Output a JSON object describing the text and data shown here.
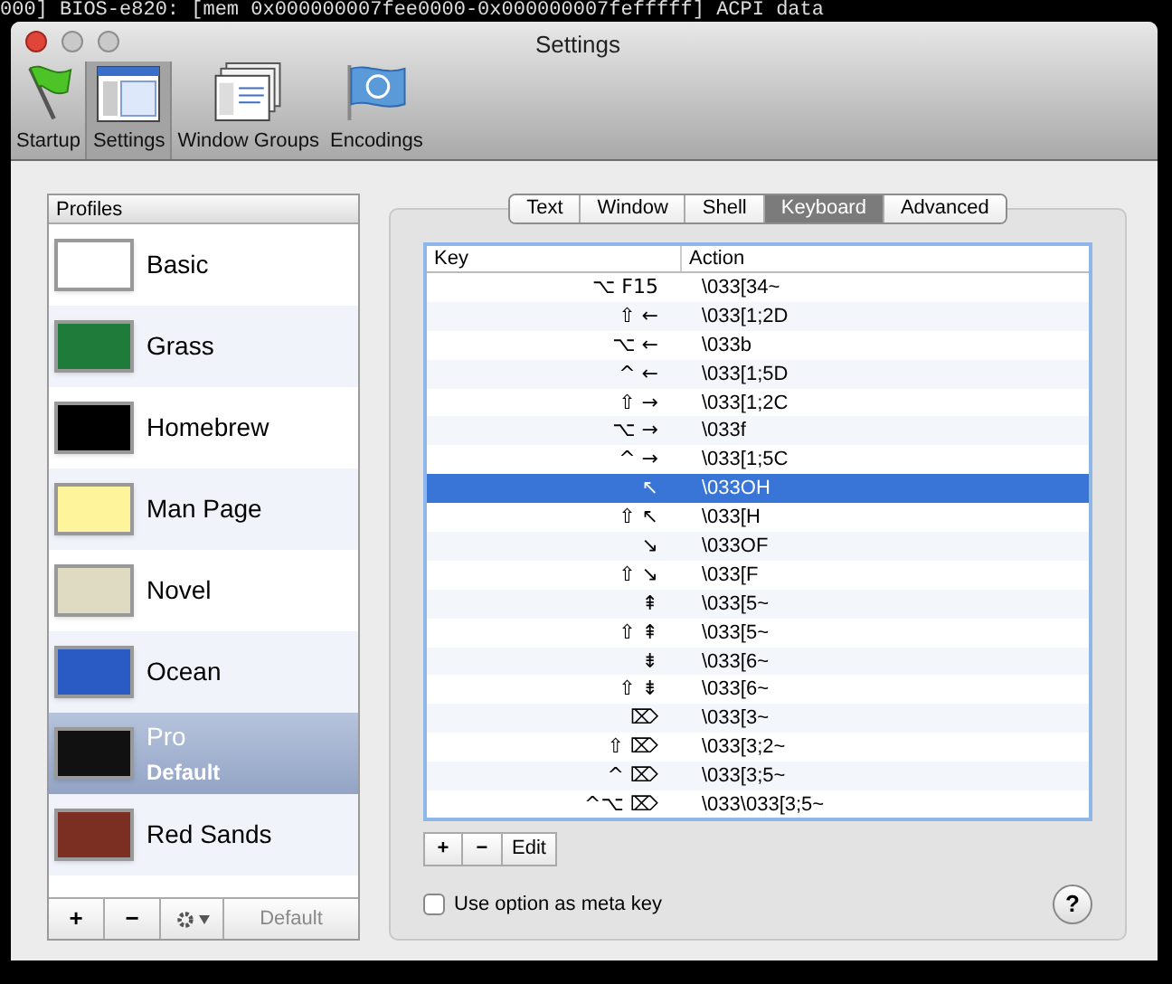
{
  "background_terminal": {
    "line": "000] BIOS-e820: [mem 0x000000007fee0000-0x000000007fefffff] ACPI data"
  },
  "window": {
    "title": "Settings"
  },
  "toolbar": [
    {
      "kind": "flag",
      "label": "Startup",
      "selected": false
    },
    {
      "kind": "settings",
      "label": "Settings",
      "selected": true
    },
    {
      "kind": "groups",
      "label": "Window Groups",
      "selected": false
    },
    {
      "kind": "globe",
      "label": "Encodings",
      "selected": false
    }
  ],
  "profiles": {
    "header": "Profiles",
    "items": [
      {
        "name": "Basic",
        "color": "#ffffff",
        "selected": false
      },
      {
        "name": "Grass",
        "color": "#1e7b3a",
        "selected": false
      },
      {
        "name": "Homebrew",
        "color": "#000000",
        "selected": false
      },
      {
        "name": "Man Page",
        "color": "#fef49c",
        "selected": false
      },
      {
        "name": "Novel",
        "color": "#dfdbc3",
        "selected": false
      },
      {
        "name": "Ocean",
        "color": "#2a5bc4",
        "selected": false
      },
      {
        "name": "Pro",
        "subtitle": "Default",
        "color": "#111111",
        "selected": true
      },
      {
        "name": "Red Sands",
        "color": "#7a2f22",
        "selected": false
      }
    ],
    "buttons": [
      "+",
      "−"
    ],
    "default_button": "Default"
  },
  "tabs": [
    {
      "label": "Text",
      "selected": false
    },
    {
      "label": "Window",
      "selected": false
    },
    {
      "label": "Shell",
      "selected": false
    },
    {
      "label": "Keyboard",
      "selected": true
    },
    {
      "label": "Advanced",
      "selected": false
    }
  ],
  "table": {
    "columns": [
      "Key",
      "Action"
    ],
    "rows": [
      {
        "key": "⌥ F15",
        "action": "\\033[34~",
        "selected": false
      },
      {
        "key": "⇧ ←",
        "action": "\\033[1;2D",
        "selected": false
      },
      {
        "key": "⌥ ←",
        "action": "\\033b",
        "selected": false
      },
      {
        "key": "^ ←",
        "action": "\\033[1;5D",
        "selected": false
      },
      {
        "key": "⇧ →",
        "action": "\\033[1;2C",
        "selected": false
      },
      {
        "key": "⌥ →",
        "action": "\\033f",
        "selected": false
      },
      {
        "key": "^ →",
        "action": "\\033[1;5C",
        "selected": false
      },
      {
        "key": "↖",
        "action": "\\033OH",
        "selected": true
      },
      {
        "key": "⇧ ↖",
        "action": "\\033[H",
        "selected": false
      },
      {
        "key": "↘",
        "action": "\\033OF",
        "selected": false
      },
      {
        "key": "⇧ ↘",
        "action": "\\033[F",
        "selected": false
      },
      {
        "key": "⇞",
        "action": "\\033[5~",
        "selected": false
      },
      {
        "key": "⇧ ⇞",
        "action": "\\033[5~",
        "selected": false
      },
      {
        "key": "⇟",
        "action": "\\033[6~",
        "selected": false
      },
      {
        "key": "⇧ ⇟",
        "action": "\\033[6~",
        "selected": false
      },
      {
        "key": "⌦",
        "action": "\\033[3~",
        "selected": false
      },
      {
        "key": "⇧ ⌦",
        "action": "\\033[3;2~",
        "selected": false
      },
      {
        "key": "^ ⌦",
        "action": "\\033[3;5~",
        "selected": false
      },
      {
        "key": "^⌥ ⌦",
        "action": "\\033\\033[3;5~",
        "selected": false
      }
    ]
  },
  "table_buttons": [
    "+",
    "−",
    "Edit"
  ],
  "meta_checkbox": {
    "label": "Use option as meta key",
    "checked": false
  },
  "help_button": "?"
}
